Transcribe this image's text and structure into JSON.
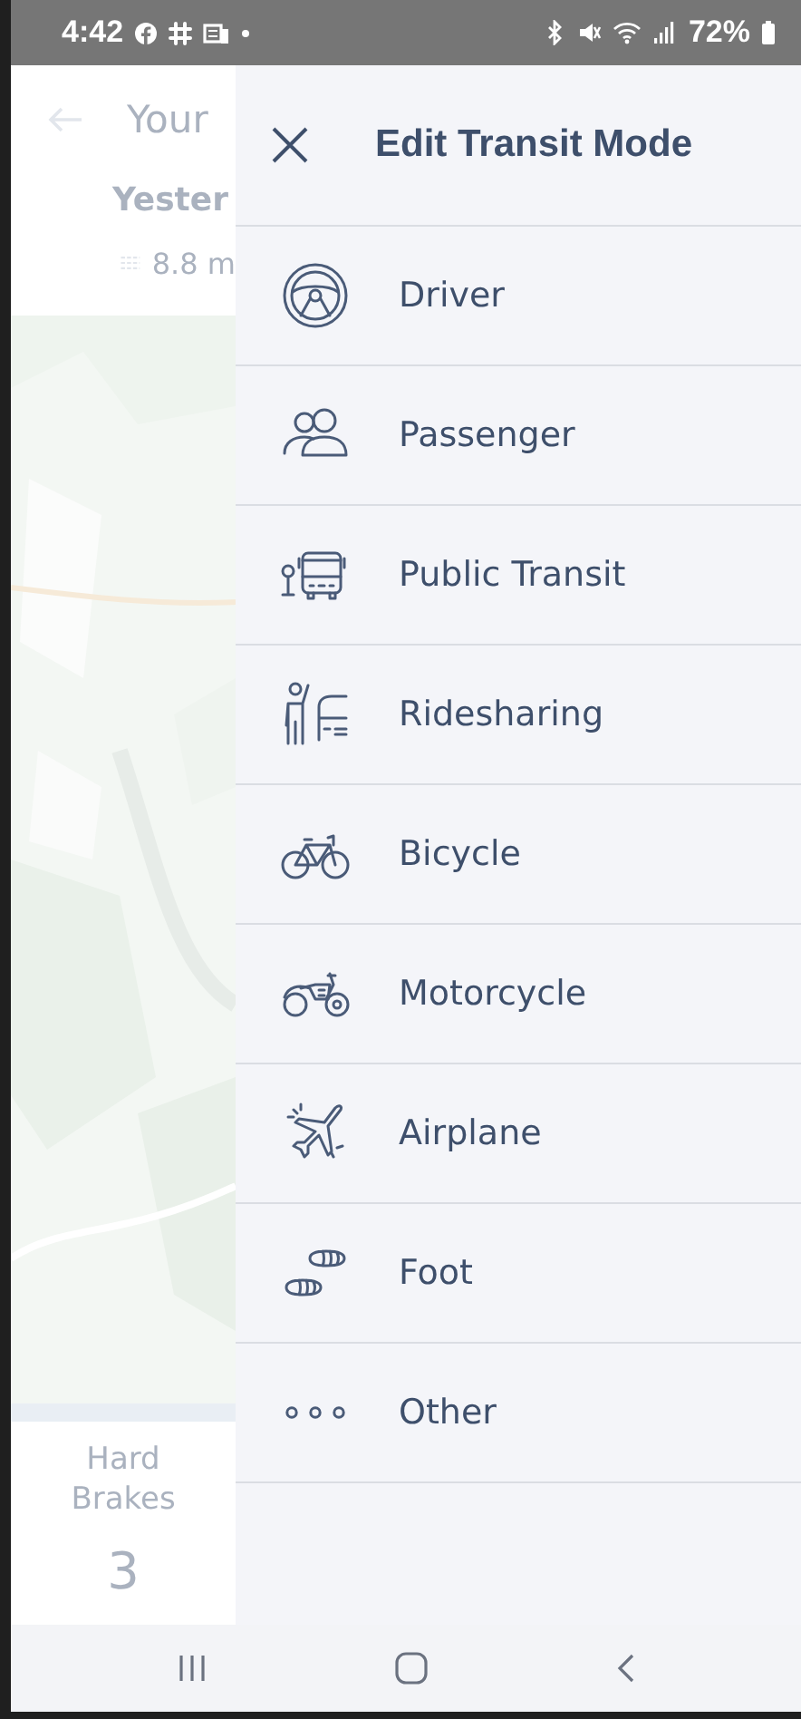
{
  "status_bar": {
    "time": "4:42",
    "battery": "72%"
  },
  "background": {
    "title": "Your",
    "subtitle": "Yester",
    "distance": "8.8 m",
    "stat_label": "Hard Brakes",
    "stat_value": "3"
  },
  "panel": {
    "title": "Edit Transit Mode",
    "modes": [
      {
        "kind": "driver",
        "label": "Driver"
      },
      {
        "kind": "passenger",
        "label": "Passenger"
      },
      {
        "kind": "transit",
        "label": "Public Transit"
      },
      {
        "kind": "rideshare",
        "label": "Ridesharing"
      },
      {
        "kind": "bicycle",
        "label": "Bicycle"
      },
      {
        "kind": "motorcycle",
        "label": "Motorcycle"
      },
      {
        "kind": "airplane",
        "label": "Airplane"
      },
      {
        "kind": "foot",
        "label": "Foot"
      },
      {
        "kind": "other",
        "label": "Other"
      }
    ]
  }
}
